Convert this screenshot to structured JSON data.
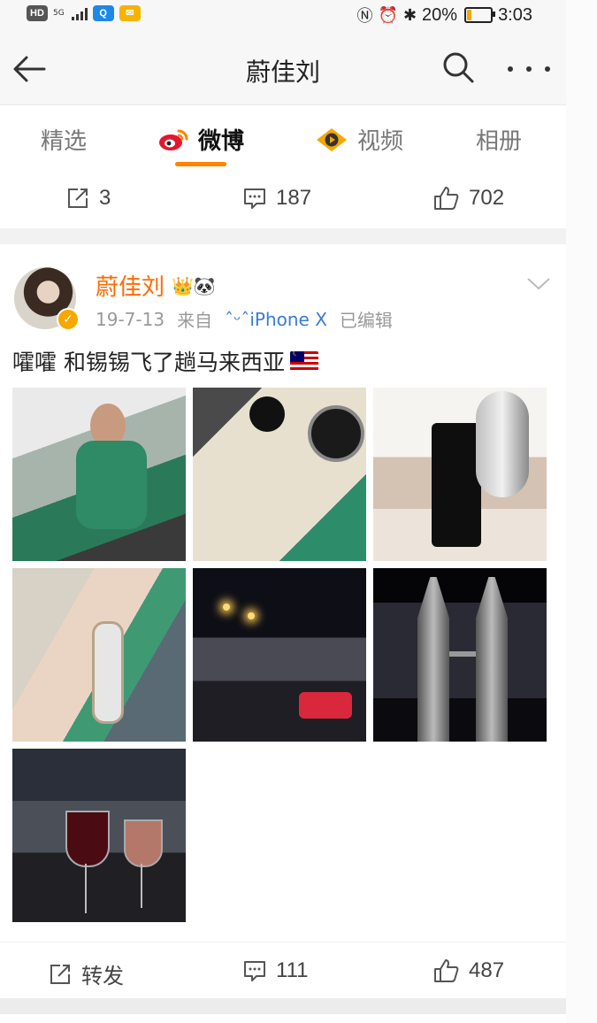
{
  "status_bar": {
    "hd": "HD",
    "network": "5G",
    "battery_text": "20%",
    "battery_level": 0.2,
    "time": "3:03"
  },
  "header": {
    "title": "蔚佳刘"
  },
  "tabs": [
    {
      "label": "精选"
    },
    {
      "label": "微博"
    },
    {
      "label": "视频"
    },
    {
      "label": "相册"
    }
  ],
  "first_post_stats": {
    "reposts": "3",
    "comments": "187",
    "likes": "702"
  },
  "post": {
    "username": "蔚佳刘",
    "badges": "👑🐼",
    "date": "19-7-13",
    "from_label": "来自",
    "source_emoji": "ˆᵕˆ",
    "source": "iPhone X",
    "edited": "已编辑",
    "text": "嚯嚯 和锡锡飞了趟马来西亚",
    "actions": {
      "repost_label": "转发",
      "comments": "111",
      "likes": "487"
    }
  },
  "colors": {
    "accent": "#ff8200",
    "username": "#ff6a00",
    "source_link": "#3a7bd5"
  }
}
